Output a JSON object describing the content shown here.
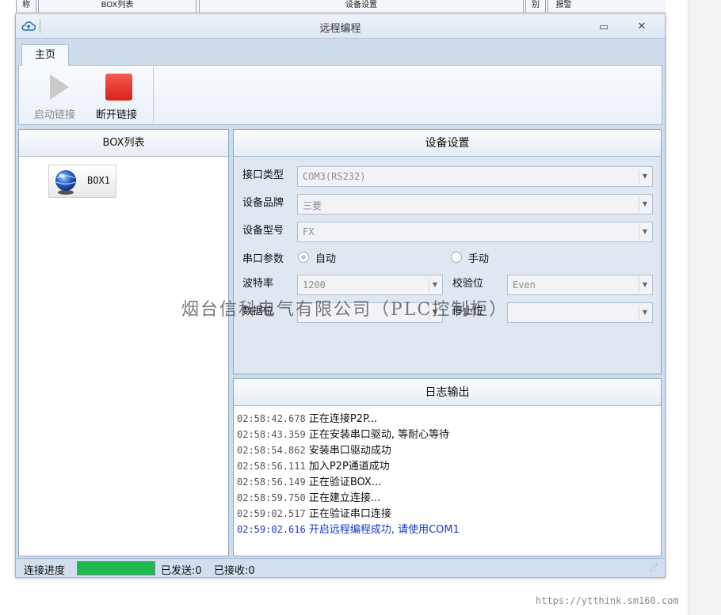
{
  "background_header": {
    "col1": "称",
    "col2": "BOX列表",
    "col3": "设备设置",
    "col4": "别",
    "col5": "报警"
  },
  "window": {
    "title": "远程编程",
    "minimize_glyph": "▭",
    "close_glyph": "✕"
  },
  "ribbon": {
    "tab": "主页",
    "start_label": "启动链接",
    "stop_label": "断开链接"
  },
  "box_list": {
    "header": "BOX列表",
    "items": [
      {
        "label": "BOX1"
      }
    ]
  },
  "device_settings": {
    "header": "设备设置",
    "interface_type_label": "接口类型",
    "interface_type_value": "COM3(RS232)",
    "brand_label": "设备品牌",
    "brand_value": "三菱",
    "model_label": "设备型号",
    "model_value": "FX",
    "serial_params_label": "串口参数",
    "auto_label": "自动",
    "manual_label": "手动",
    "serial_mode_selected": "自动",
    "baud_label": "波特率",
    "baud_value": "1200",
    "parity_label": "校验位",
    "parity_value": "Even",
    "databits_label": "数据位",
    "stopbits_label": "停止位"
  },
  "log": {
    "header": "日志输出",
    "lines": [
      {
        "time": "02:58:42.678",
        "msg": "正在连接P2P..."
      },
      {
        "time": "02:58:43.359",
        "msg": "正在安装串口驱动, 等耐心等待"
      },
      {
        "time": "02:58:54.862",
        "msg": "安装串口驱动成功"
      },
      {
        "time": "02:58:56.111",
        "msg": "加入P2P通道成功"
      },
      {
        "time": "02:58:56.149",
        "msg": "正在验证BOX..."
      },
      {
        "time": "02:58:59.750",
        "msg": "正在建立连接..."
      },
      {
        "time": "02:59:02.517",
        "msg": "正在验证串口连接"
      },
      {
        "time": "02:59:02.616",
        "msg": "开启远程编程成功, 请使用COM1"
      }
    ],
    "highlight_color": "#1b38c9"
  },
  "status": {
    "progress_label": "连接进度",
    "progress_fraction": 1.0,
    "progress_color": "#1fb84f",
    "sent": "已发送:0",
    "received": "已接收:0"
  },
  "watermark": "烟台信科电气有限公司（PLC控制柜）",
  "site_url": "https://ytthink.sm160.com",
  "icons": {
    "app": "cloud-icon",
    "start": "play-icon",
    "stop": "stop-icon",
    "box": "globe-icon"
  },
  "colors": {
    "stop_button": "#e5302a",
    "start_button_disabled": "#c9c9c9",
    "window_frame": "#cfdcec"
  }
}
